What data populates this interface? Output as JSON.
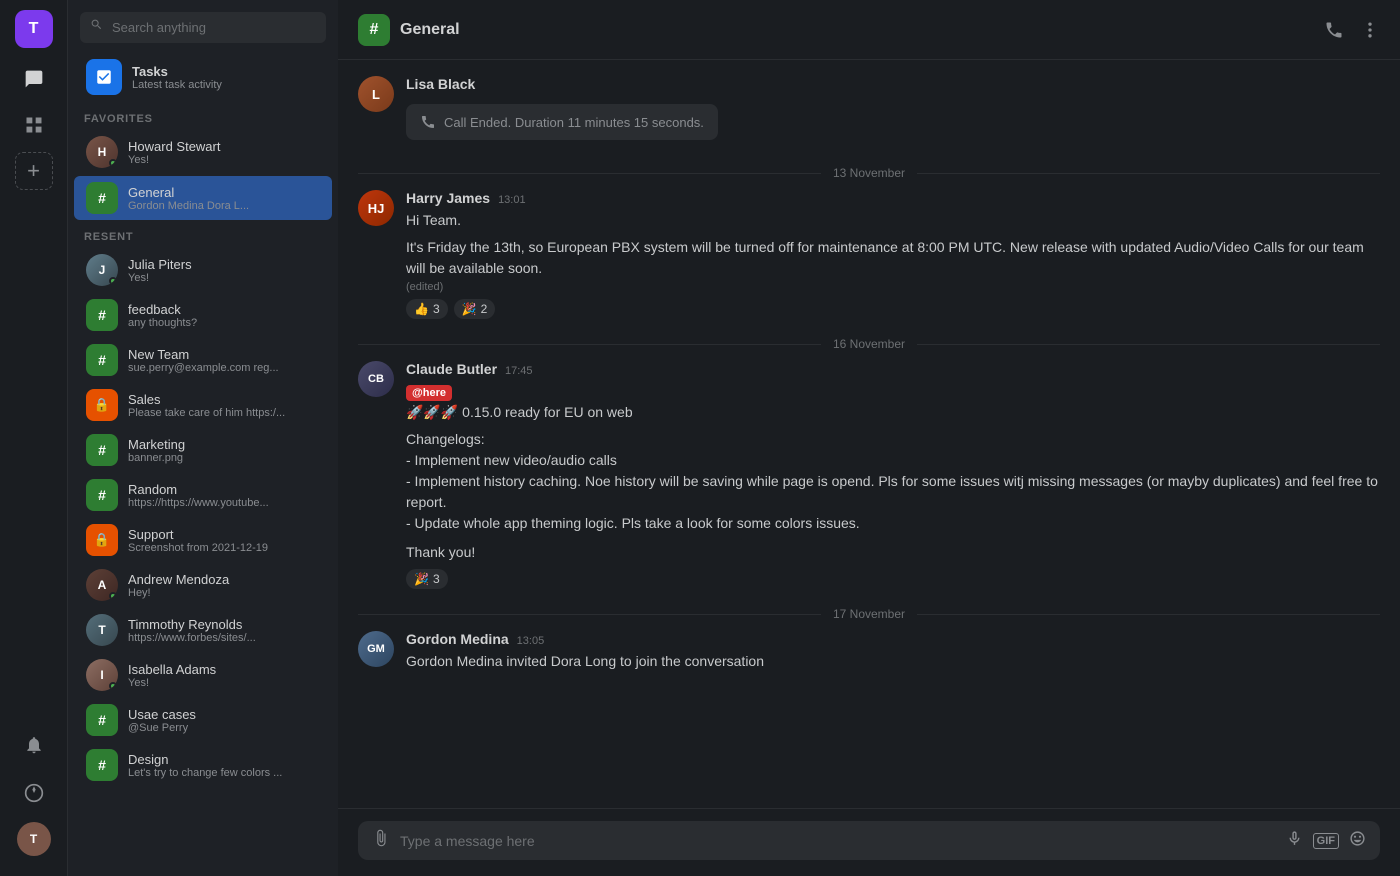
{
  "workspace": {
    "initial": "T"
  },
  "sidebar": {
    "search_placeholder": "Search anything",
    "tasks": {
      "title": "Tasks",
      "subtitle": "Latest task activity"
    },
    "sections": {
      "favorites_label": "FAVORITES",
      "recent_label": "RESENT"
    },
    "favorites": [
      {
        "id": "howard",
        "name": "Howard Stewart",
        "preview": "Yes!",
        "type": "user",
        "online": true,
        "avatar_color": "av-howard",
        "initials": "H"
      },
      {
        "id": "general",
        "name": "General",
        "preview": "Gordon Medina Dora L...",
        "type": "channel",
        "color": "green",
        "symbol": "#",
        "active": true
      }
    ],
    "recent": [
      {
        "id": "julia",
        "name": "Julia Piters",
        "preview": "Yes!",
        "type": "user",
        "online": true,
        "avatar_color": "av-julia",
        "initials": "J"
      },
      {
        "id": "feedback",
        "name": "feedback",
        "preview": "any thoughts?",
        "type": "channel",
        "color": "green",
        "symbol": "#"
      },
      {
        "id": "newteam",
        "name": "New Team",
        "preview": "sue.perry@example.com reg...",
        "type": "channel",
        "color": "green",
        "symbol": "#"
      },
      {
        "id": "sales",
        "name": "Sales",
        "preview": "Please take care of him https:/...",
        "type": "channel",
        "color": "orange",
        "symbol": "🔒"
      },
      {
        "id": "marketing",
        "name": "Marketing",
        "preview": "banner.png",
        "type": "channel",
        "color": "green",
        "symbol": "#"
      },
      {
        "id": "random",
        "name": "Random",
        "preview": "https://https://www.youtube...",
        "type": "channel",
        "color": "green",
        "symbol": "#"
      },
      {
        "id": "support",
        "name": "Support",
        "preview": "Screenshot from 2021-12-19",
        "type": "channel",
        "color": "orange",
        "symbol": "🔒"
      },
      {
        "id": "andrew",
        "name": "Andrew Mendoza",
        "preview": "Hey!",
        "type": "user",
        "online": true,
        "avatar_color": "av-andrew",
        "initials": "A"
      },
      {
        "id": "tim",
        "name": "Timmothy Reynolds",
        "preview": "https://www.forbes/sites/...",
        "type": "user",
        "online": false,
        "avatar_color": "av-tim",
        "initials": "T"
      },
      {
        "id": "isabella",
        "name": "Isabella Adams",
        "preview": "Yes!",
        "type": "user",
        "online": true,
        "avatar_color": "av-isabella",
        "initials": "I"
      },
      {
        "id": "usecases",
        "name": "Usae cases",
        "preview": "@Sue Perry",
        "type": "channel",
        "color": "green",
        "symbol": "#"
      },
      {
        "id": "design",
        "name": "Design",
        "preview": "Let's try to change few colors ...",
        "type": "channel",
        "color": "green",
        "symbol": "#"
      }
    ]
  },
  "chat": {
    "channel_name": "General",
    "messages": [
      {
        "id": "call-ended",
        "author": "Lisa Black",
        "avatar_color": "av-lisa",
        "initials": "L",
        "text": "Call Ended. Duration 11 minutes 15 seconds.",
        "type": "call-ended"
      }
    ],
    "date_dividers": {
      "d1": "13 November",
      "d2": "16  November",
      "d3": "17  November"
    },
    "harry_message": {
      "author": "Harry James",
      "time": "13:01",
      "avatar_color": "av-harry",
      "initials": "HJ",
      "text1": "Hi Team.",
      "text2": "It's Friday the 13th, so European PBX system will be turned off for maintenance at 8:00 PM UTC. New release with updated Audio/Video Calls for our team will be available soon.",
      "edited": "(edited)",
      "reactions": [
        {
          "emoji": "👍",
          "count": "3"
        },
        {
          "emoji": "🎉",
          "count": "2"
        }
      ]
    },
    "claude_message": {
      "author": "Claude Butler",
      "time": "17:45",
      "avatar_color": "av-claude",
      "initials": "CB",
      "here_badge": "@here",
      "text1": "🚀🚀🚀 0.15.0 ready for EU on web",
      "text2": "Changelogs:\n- Implement new video/audio calls\n- Implement history caching. Noe history will be saving while page is opend. Pls for some issues witj missing messages (or mayby duplicates) and  feel free to report.\n- Update whole app theming logic. Pls take a look for some colors issues.",
      "text3": "Thank you!",
      "reactions": [
        {
          "emoji": "🎉",
          "count": "3"
        }
      ]
    },
    "gordon_message": {
      "author": "Gordon Medina",
      "time": "13:05",
      "avatar_color": "av-gordon",
      "initials": "GM",
      "text": "Gordon Medina invited Dora Long to join the conversation"
    },
    "input_placeholder": "Type a message here"
  },
  "icons": {
    "search": "🔍",
    "tasks_icon": "📋",
    "phone": "📞",
    "more": "⋮",
    "attach": "📎",
    "mic": "🎙",
    "gif": "GIF",
    "emoji": "😊",
    "chat_nav": "💬",
    "grid_nav": "⊞",
    "add_nav": "+",
    "bell_nav": "🔔",
    "soccer_nav": "⚽"
  }
}
